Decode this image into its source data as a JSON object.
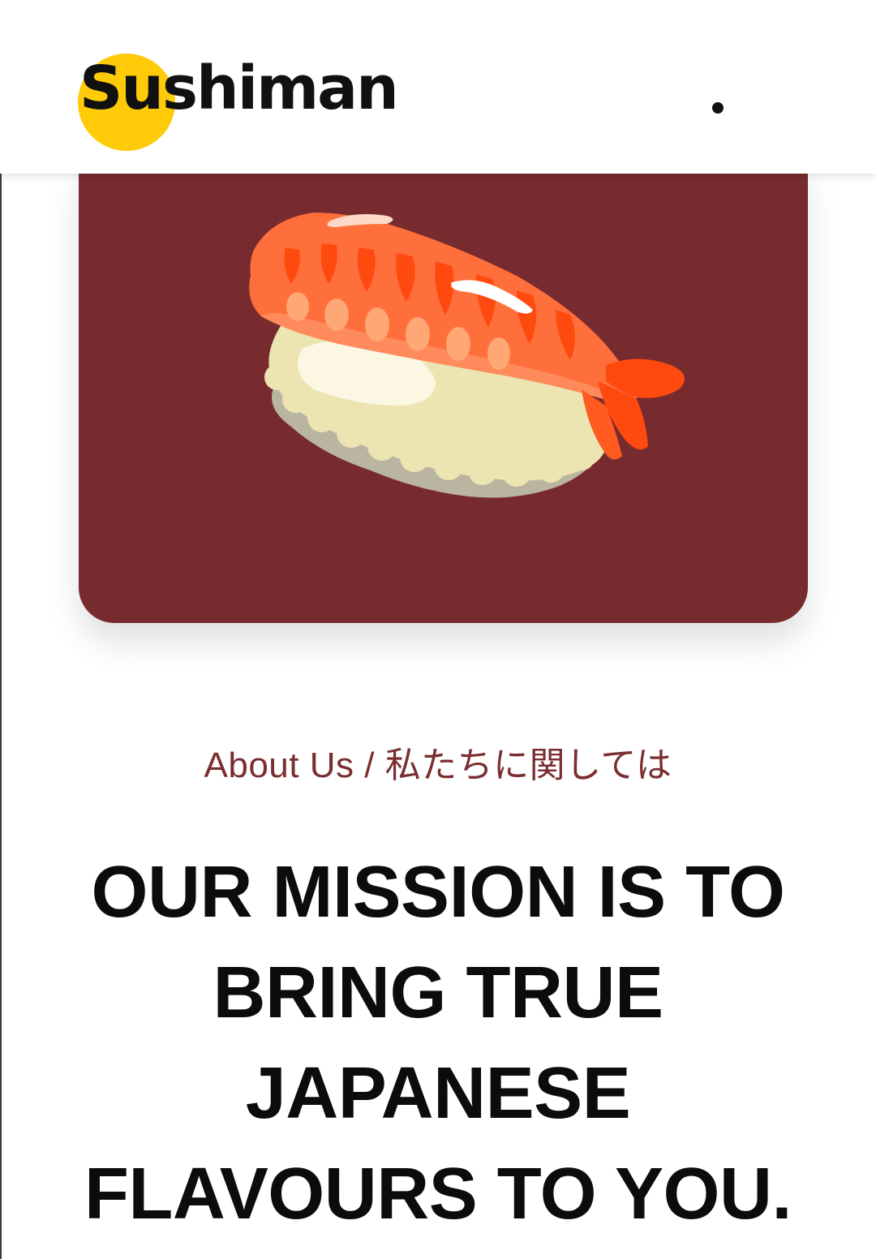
{
  "header": {
    "logo_text": "Sushiman",
    "logo_accent_color": "#ffcb08",
    "menu_icon": "dot-menu-icon"
  },
  "hero": {
    "image": "shrimp-nigiri-sushi-illustration",
    "background_color": "#772b2e"
  },
  "about": {
    "eyebrow": "About Us / 私たちに関しては",
    "headline": "OUR MISSION IS TO BRING TRUE JAPANESE FLAVOURS TO YOU."
  }
}
